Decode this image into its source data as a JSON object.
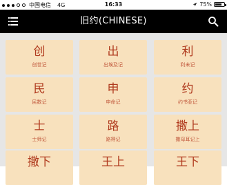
{
  "status_bar": {
    "carrier": "中国电信",
    "network": "4G",
    "time": "16:33",
    "battery_text": "75%",
    "battery_level": 0.75
  },
  "app_bar": {
    "title": "旧约(CHINESE)",
    "menu_icon": "hamburger-menu-icon",
    "search_icon": "search-icon"
  },
  "books": [
    {
      "char": "创",
      "name": "创世记"
    },
    {
      "char": "出",
      "name": "出埃及记"
    },
    {
      "char": "利",
      "name": "利未记"
    },
    {
      "char": "民",
      "name": "民数记"
    },
    {
      "char": "申",
      "name": "申命记"
    },
    {
      "char": "约",
      "name": "约书亚记"
    },
    {
      "char": "士",
      "name": "士师记"
    },
    {
      "char": "路",
      "name": "路得记"
    },
    {
      "char": "撒上",
      "name": "撒母耳记上"
    },
    {
      "char": "撒下",
      "name": ""
    },
    {
      "char": "王上",
      "name": ""
    },
    {
      "char": "王下",
      "name": ""
    }
  ],
  "colors": {
    "app_bar_bg": "#000000",
    "tile_bg": "#f8e1bd",
    "tile_text": "#b03a1e",
    "grid_bg": "#e6e6e6"
  }
}
